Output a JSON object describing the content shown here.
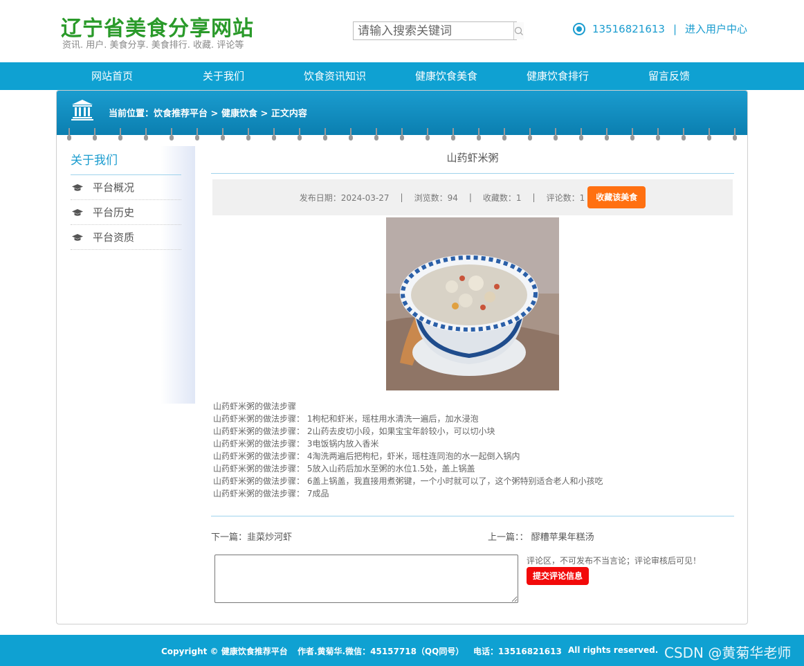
{
  "header": {
    "site_title": "辽宁省美食分享网站",
    "site_subtitle": "资讯. 用户. 美食分享. 美食排行. 收藏. 评论等",
    "search_placeholder": "请输入搜索关键词",
    "phone": "13516821613",
    "separator": "|",
    "user_center": "进入用户中心"
  },
  "nav": {
    "items": [
      {
        "label": "网站首页"
      },
      {
        "label": "关于我们"
      },
      {
        "label": "饮食资讯知识"
      },
      {
        "label": "健康饮食美食"
      },
      {
        "label": "健康饮食排行"
      },
      {
        "label": "留言反馈"
      }
    ]
  },
  "breadcrumb": "当前位置：饮食推荐平台 > 健康饮食 > 正文内容",
  "sidebar": {
    "title": "关于我们",
    "items": [
      {
        "label": "平台概况"
      },
      {
        "label": "平台历史"
      },
      {
        "label": "平台资质"
      }
    ]
  },
  "article": {
    "title": "山药虾米粥",
    "meta": {
      "publish": "发布日期：2024-03-27",
      "views": "浏览数：94",
      "favs": "收藏数：1",
      "comments": "评论数：1",
      "sep": "|"
    },
    "fav_button": "收藏该美食",
    "steps": [
      "山药虾米粥的做法步骤",
      "山药虾米粥的做法步骤： 1枸杞和虾米，瑶柱用水清洗一遍后，加水浸泡",
      "山药虾米粥的做法步骤： 2山药去皮切小段，如果宝宝年龄较小，可以切小块",
      "山药虾米粥的做法步骤： 3电饭锅内放入香米",
      "山药虾米粥的做法步骤： 4淘洗两遍后把枸杞，虾米，瑶柱连同泡的水一起倒入锅内",
      "山药虾米粥的做法步骤： 5放入山药后加水至粥的水位1.5处，盖上锅盖",
      "山药虾米粥的做法步骤： 6盖上锅盖，我直接用煮粥键，一个小时就可以了，这个粥特别适合老人和小孩吃",
      "山药虾米粥的做法步骤： 7成品"
    ],
    "next": "下一篇：韭菜炒河虾",
    "prev": "上一篇：：  醪糟苹果年糕汤"
  },
  "comment": {
    "note": "评论区，不可发布不当言论；评论审核后可见！",
    "submit": "提交评论信息"
  },
  "footer": {
    "copyright": "Copyright © 健康饮食推荐平台",
    "author": "作者.黄菊华.微信：45157718（QQ同号）",
    "phone": "电话：13516821613",
    "rights": "All rights reserved."
  },
  "watermark": "CSDN @黄菊华老师",
  "colors": {
    "brand_green": "#2a9a2a",
    "nav_blue": "#0fa1d2",
    "fav_orange": "#ff7011",
    "submit_red": "#f20a0a"
  }
}
